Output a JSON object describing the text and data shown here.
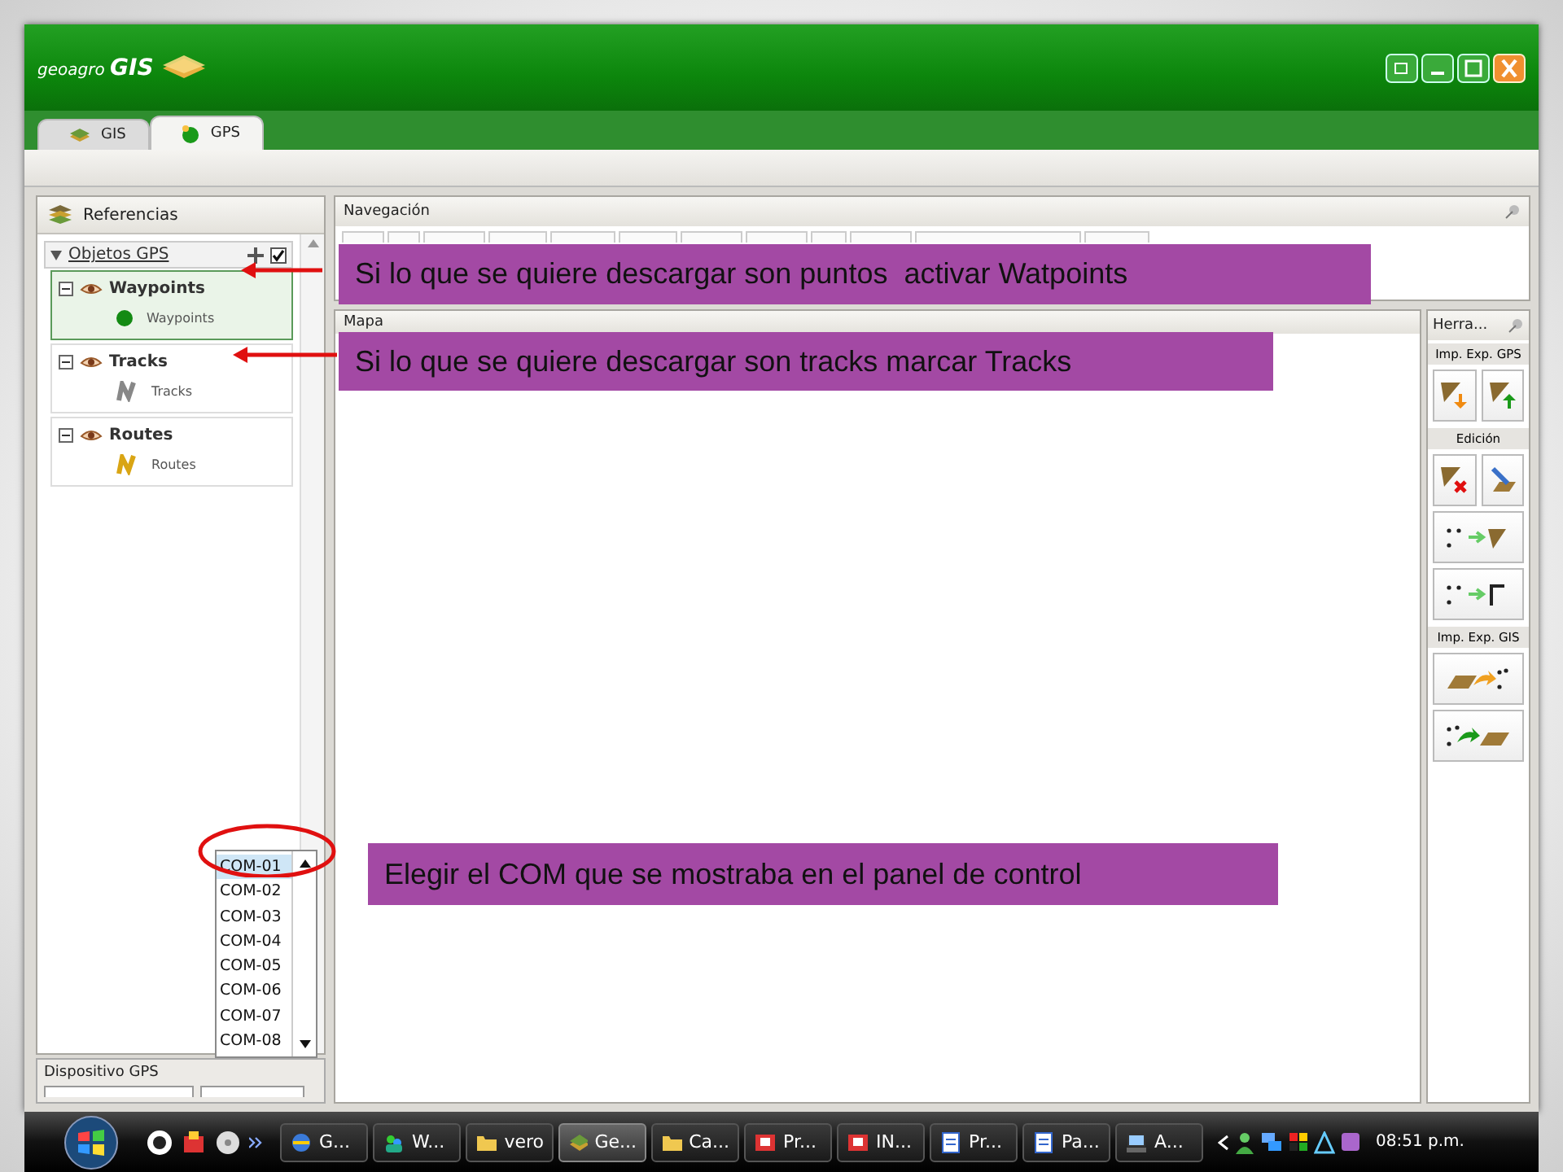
{
  "window": {
    "logo": "geoagro GIS",
    "tabs": [
      {
        "label": "GIS",
        "selected": false
      },
      {
        "label": "GPS",
        "selected": true
      }
    ]
  },
  "references_panel": {
    "title": "Referencias",
    "root": {
      "label": "Objetos GPS",
      "expanded": true,
      "checked": true,
      "children": [
        {
          "label": "Waypoints",
          "selected": true,
          "expanded": true,
          "children": [
            {
              "label": "Waypoints",
              "kind": "point"
            }
          ]
        },
        {
          "label": "Tracks",
          "selected": false,
          "expanded": true,
          "children": [
            {
              "label": "Tracks",
              "kind": "track"
            }
          ]
        },
        {
          "label": "Routes",
          "selected": false,
          "expanded": true,
          "children": [
            {
              "label": "Routes",
              "kind": "route"
            }
          ]
        }
      ]
    }
  },
  "navigation_panel": {
    "title": "Navegación"
  },
  "map_panel": {
    "title": "Mapa"
  },
  "tools_panel": {
    "title": "Herra...",
    "sections": [
      {
        "title": "Imp. Exp. GPS",
        "buttons": [
          {
            "kind": "import"
          },
          {
            "kind": "export"
          }
        ]
      },
      {
        "title": "Edición",
        "buttons": [
          {
            "kind": "delete"
          },
          {
            "kind": "edit"
          },
          {
            "kind": "points-to-track"
          },
          {
            "kind": "points-to-route"
          }
        ]
      },
      {
        "title": "Imp. Exp. GIS",
        "buttons": [
          {
            "kind": "polygon-to-points"
          },
          {
            "kind": "points-to-polygon"
          }
        ]
      }
    ]
  },
  "gps_device_panel": {
    "title": "Dispositivo GPS"
  },
  "com_dropdown": {
    "options": [
      {
        "label": "COM-01",
        "selected": true
      },
      {
        "label": "COM-02",
        "selected": false
      },
      {
        "label": "COM-03",
        "selected": false
      },
      {
        "label": "COM-04",
        "selected": false
      },
      {
        "label": "COM-05",
        "selected": false
      },
      {
        "label": "COM-06",
        "selected": false
      },
      {
        "label": "COM-07",
        "selected": false
      },
      {
        "label": "COM-08",
        "selected": false
      }
    ]
  },
  "callouts": [
    {
      "text": "Si lo que se quiere descargar son puntos  activar Watpoints"
    },
    {
      "text": "Si lo que se quiere descargar son tracks marcar Tracks"
    },
    {
      "text": "Elegir el COM que se mostraba en el panel de control"
    }
  ],
  "taskbar": {
    "items": [
      {
        "label": "G...",
        "kind": "browser",
        "selected": false
      },
      {
        "label": "W...",
        "kind": "messenger",
        "selected": false
      },
      {
        "label": "vero",
        "kind": "folder",
        "selected": false
      },
      {
        "label": "Ge...",
        "kind": "gis",
        "selected": true
      },
      {
        "label": "Ca...",
        "kind": "folder",
        "selected": false
      },
      {
        "label": "Pr...",
        "kind": "slides",
        "selected": false
      },
      {
        "label": "IN...",
        "kind": "slides",
        "selected": false
      },
      {
        "label": "Pr...",
        "kind": "document",
        "selected": false
      },
      {
        "label": "Pa...",
        "kind": "document",
        "selected": false
      },
      {
        "label": "A...",
        "kind": "computer",
        "selected": false
      }
    ],
    "clock": "08:51 p.m."
  }
}
